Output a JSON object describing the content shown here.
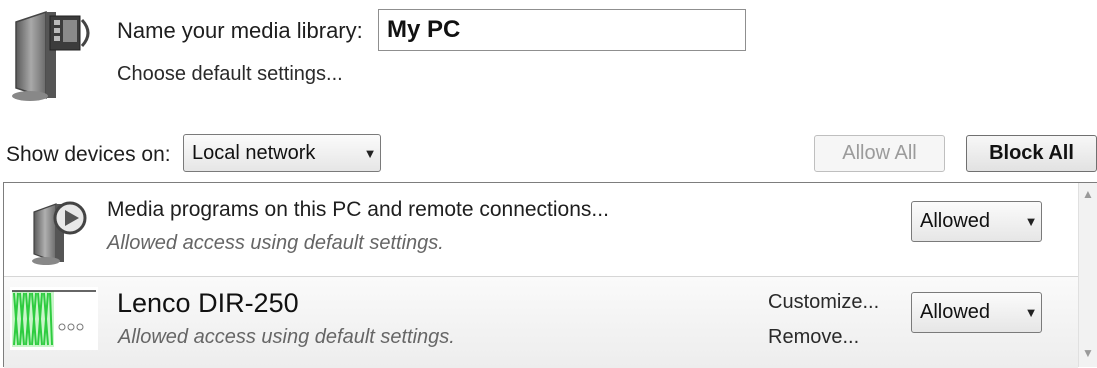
{
  "header": {
    "library_label": "Name your media library:",
    "library_name": "My PC",
    "choose_defaults": "Choose default settings..."
  },
  "devices_bar": {
    "show_label": "Show devices on:",
    "network_selected": "Local network",
    "allow_all": "Allow All",
    "block_all": "Block All"
  },
  "devices": [
    {
      "icon": "media-programs-icon",
      "title": "Media programs on this PC and remote connections...",
      "status": "Allowed access using default settings.",
      "access": "Allowed"
    },
    {
      "icon": "device-thumbnail",
      "title": "Lenco DIR-250",
      "status": "Allowed access using default settings.",
      "customize": "Customize...",
      "remove": "Remove...",
      "access": "Allowed"
    }
  ],
  "colors": {
    "disabled_text": "#9b9b9b",
    "thumbnail_green": "#2ecc40",
    "border": "#7d7d7d"
  }
}
